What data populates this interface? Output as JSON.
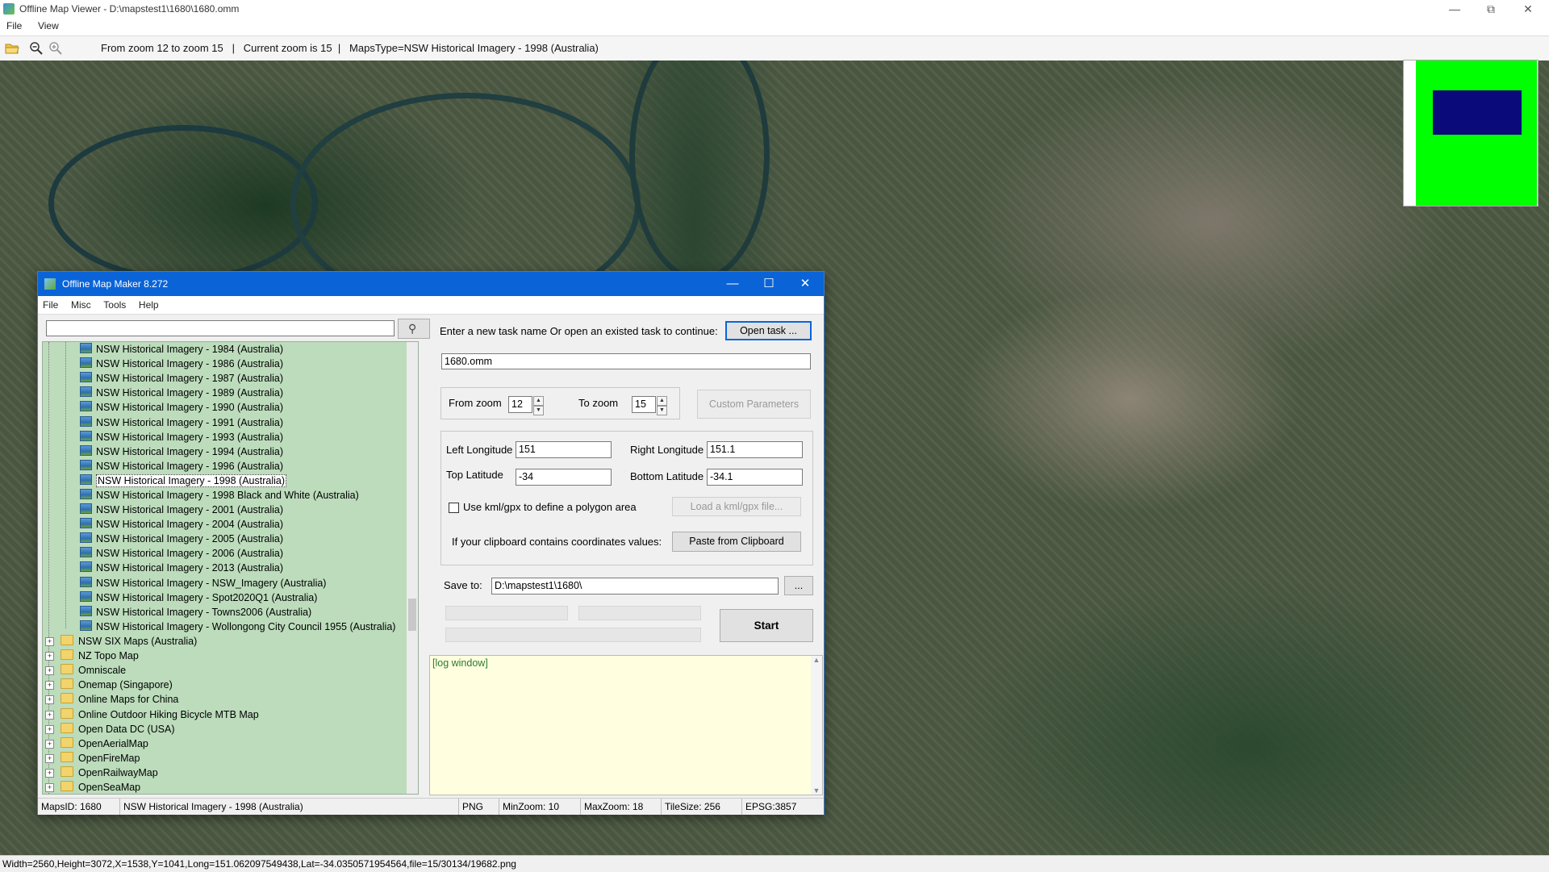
{
  "viewer": {
    "title": "Offline Map Viewer - D:\\mapstest1\\1680\\1680.omm",
    "menu": [
      "File",
      "View"
    ],
    "toolbar_status": "From zoom 12 to zoom 15   |   Current zoom is 15  |   MapsType=NSW Historical Imagery - 1998 (Australia)",
    "statusbar": "Width=2560,Height=3072,X=1538,Y=1041,Long=151.062097549438,Lat=-34.0350571954564,file=15/30134/19682.png"
  },
  "dialog": {
    "title": "Offline Map Maker 8.272",
    "menu": [
      "File",
      "Misc",
      "Tools",
      "Help"
    ],
    "search_value": "",
    "tree": {
      "children": [
        "NSW Historical Imagery - 1984 (Australia)",
        "NSW Historical Imagery - 1986 (Australia)",
        "NSW Historical Imagery - 1987 (Australia)",
        "NSW Historical Imagery - 1989 (Australia)",
        "NSW Historical Imagery - 1990 (Australia)",
        "NSW Historical Imagery - 1991 (Australia)",
        "NSW Historical Imagery - 1993 (Australia)",
        "NSW Historical Imagery - 1994 (Australia)",
        "NSW Historical Imagery - 1996 (Australia)",
        "NSW Historical Imagery - 1998 (Australia)",
        "NSW Historical Imagery - 1998 Black and White (Australia)",
        "NSW Historical Imagery - 2001 (Australia)",
        "NSW Historical Imagery - 2004 (Australia)",
        "NSW Historical Imagery - 2005 (Australia)",
        "NSW Historical Imagery - 2006 (Australia)",
        "NSW Historical Imagery - 2013 (Australia)",
        "NSW Historical Imagery - NSW_Imagery (Australia)",
        "NSW Historical Imagery - Spot2020Q1 (Australia)",
        "NSW Historical Imagery - Towns2006 (Australia)",
        "NSW Historical Imagery - Wollongong City Council 1955 (Australia)"
      ],
      "selected": "NSW Historical Imagery - 1998 (Australia)",
      "folders": [
        "NSW SIX Maps (Australia)",
        "NZ Topo Map",
        "Omniscale",
        "Onemap (Singapore)",
        "Online Maps for China",
        "Online Outdoor Hiking Bicycle MTB Map",
        "Open Data DC (USA)",
        "OpenAerialMap",
        "OpenFireMap",
        "OpenRailwayMap",
        "OpenSeaMap"
      ]
    },
    "task_prompt": "Enter a new task name Or open an existed task to continue:",
    "open_task_label": "Open task ...",
    "task_name": "1680.omm",
    "from_zoom_label": "From zoom",
    "from_zoom": "12",
    "to_zoom_label": "To zoom",
    "to_zoom": "15",
    "custom_params_label": "Custom Parameters",
    "left_lon_label": "Left Longitude",
    "left_lon": "151",
    "right_lon_label": "Right Longitude",
    "right_lon": "151.1",
    "top_lat_label": "Top Latitude",
    "top_lat": "-34",
    "bottom_lat_label": "Bottom Latitude",
    "bottom_lat": "-34.1",
    "kml_label": "Use kml/gpx to define a polygon area",
    "load_kml_label": "Load a kml/gpx file...",
    "clipboard_prompt": "If your clipboard contains coordinates values:",
    "paste_label": "Paste from Clipboard",
    "save_to_label": "Save to:",
    "save_to": "D:\\mapstest1\\1680\\",
    "browse_label": "...",
    "start_label": "Start",
    "log_text": "[log window]",
    "status": {
      "maps_id": "MapsID: 1680",
      "maps_name": "NSW Historical Imagery - 1998 (Australia)",
      "format": "PNG",
      "min_zoom": "MinZoom: 10",
      "max_zoom": "MaxZoom: 18",
      "tile_size": "TileSize: 256",
      "epsg": "EPSG:3857"
    }
  }
}
